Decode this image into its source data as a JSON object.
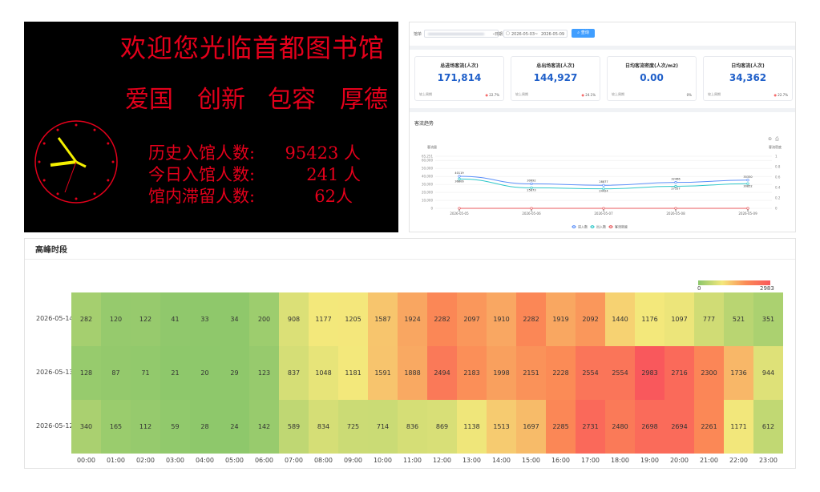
{
  "led": {
    "title": "欢迎您光临首都图书馆",
    "motto": [
      "爱国",
      "创新",
      "包容",
      "厚德"
    ],
    "stats": [
      {
        "label": "历史入馆人数:",
        "value": "95423",
        "unit": "人"
      },
      {
        "label": "今日入馆人数:",
        "value": "241",
        "unit": "人"
      },
      {
        "label": "馆内滞留人数:",
        "value": "62",
        "unit": "人"
      }
    ],
    "colors": {
      "text": "#e3001b",
      "background": "#000000",
      "clock_hands": "#f4f000"
    }
  },
  "dashboard": {
    "filter": {
      "venue_label": "馆单",
      "date_label": "日期",
      "date_start": "2026-05-03",
      "date_sep": "~",
      "date_end": "2026-05-09",
      "query_button": "查询"
    },
    "cards": [
      {
        "title": "总进场客流(人次)",
        "value": "171,814",
        "footer": "较上周期",
        "pct": "22.7%"
      },
      {
        "title": "总出场客流(人次)",
        "value": "144,927",
        "footer": "较上周期",
        "pct": "24.1%"
      },
      {
        "title": "日均客流密度(人次/m2)",
        "value": "0.00",
        "footer": "较上周期",
        "pct": "0%"
      },
      {
        "title": "日均客流(人次)",
        "value": "34,362",
        "footer": "较上周期",
        "pct": "22.7%"
      }
    ],
    "trend_title": "客流趋势",
    "accent": "#1f5fc9"
  },
  "heatmap": {
    "title": "高峰时段",
    "rows": [
      "2026-05-14",
      "2026-05-13",
      "2026-05-12"
    ],
    "hours": [
      "00:00",
      "01:00",
      "02:00",
      "03:00",
      "04:00",
      "05:00",
      "06:00",
      "07:00",
      "08:00",
      "09:00",
      "10:00",
      "11:00",
      "12:00",
      "13:00",
      "14:00",
      "15:00",
      "16:00",
      "17:00",
      "18:00",
      "19:00",
      "20:00",
      "21:00",
      "22:00",
      "23:00"
    ],
    "legend_min": "0",
    "legend_max": "2983",
    "values": [
      [
        282,
        120,
        122,
        41,
        33,
        34,
        200,
        908,
        1177,
        1205,
        1587,
        1924,
        2282,
        2097,
        1910,
        2282,
        1919,
        2092,
        1440,
        1176,
        1097,
        777,
        521,
        351
      ],
      [
        128,
        87,
        71,
        21,
        20,
        29,
        123,
        837,
        1048,
        1181,
        1591,
        1888,
        2494,
        2183,
        1998,
        2151,
        2228,
        2554,
        2554,
        2983,
        2716,
        2300,
        1736,
        944
      ],
      [
        340,
        165,
        112,
        59,
        28,
        24,
        142,
        589,
        834,
        725,
        714,
        836,
        869,
        1138,
        1513,
        1697,
        2285,
        2731,
        2480,
        2698,
        2694,
        2261,
        1171,
        612
      ]
    ]
  },
  "chart_data": {
    "type": "line",
    "title": "",
    "categories": [
      "2026-05-05",
      "2026-05-06",
      "2026-05-07",
      "2026-05-08",
      "2026-05-09"
    ],
    "ylabel": "客流量",
    "y2label": "客流密度",
    "ylim": [
      0,
      65251
    ],
    "y_ticks": [
      "65,251",
      "60,000",
      "50,000",
      "40,000",
      "30,000",
      "20,000",
      "10,000",
      "0"
    ],
    "y2lim": [
      0,
      1
    ],
    "y2_ticks": [
      "1",
      "0.8",
      "0.6",
      "0.4",
      "0.2",
      "0"
    ],
    "series": [
      {
        "name": "进入数",
        "color": "#5b8ff9",
        "values": [
          40119,
          30692,
          28877,
          32466,
          35330
        ],
        "label_color": "#333"
      },
      {
        "name": "出入数",
        "color": "#2ec7c9",
        "values": [
          36806,
          25673,
          24424,
          27557,
          30852
        ],
        "label_color": "#333"
      },
      {
        "name": "客流密度",
        "color": "#e8585c",
        "values": [
          0,
          0,
          0,
          0,
          0
        ],
        "label_color": "#333"
      }
    ],
    "legend_position": "bottom"
  }
}
